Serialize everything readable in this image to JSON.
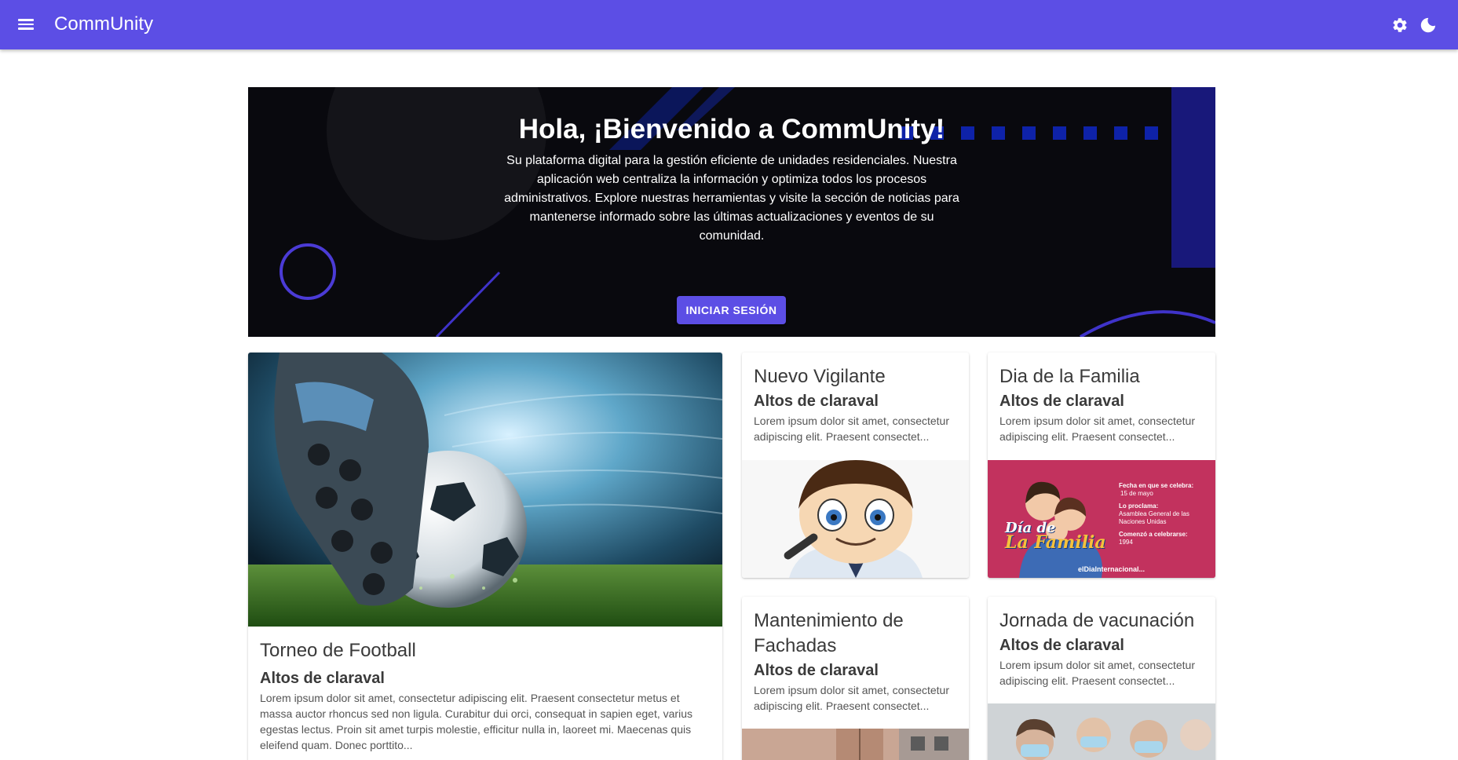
{
  "app": {
    "title": "CommUnity",
    "menu_icon": "menu-icon",
    "settings_icon": "gear-icon",
    "theme_icon": "moon-icon",
    "brand_color": "#5c4ee5"
  },
  "hero": {
    "title": "Hola, ¡Bienvenido a CommUnity!",
    "description": "Su plataforma digital para la gestión eficiente de unidades residenciales. Nuestra aplicación web centraliza la información y optimiza todos los procesos administrativos. Explore nuestras herramientas y visite la sección de noticias para mantenerse informado sobre las últimas actualizaciones y eventos de su comunidad.",
    "login_label": "INICIAR SESIÓN"
  },
  "news": [
    {
      "title": "Torneo de Football",
      "subtitle": "Altos de claraval",
      "text": "Lorem ipsum dolor sit amet, consectetur adipiscing elit. Praesent consectetur metus et massa auctor rhoncus sed non ligula. Curabitur dui orci, consequat in sapien eget, varius egestas lectus. Proin sit amet turpis molestie, efficitur nulla in, laoreet mi. Maecenas quis eleifend quam. Donec porttito..."
    },
    {
      "title": "Nuevo Vigilante",
      "subtitle": "Altos de claraval",
      "text": "Lorem ipsum dolor sit amet, consectetur adipiscing elit. Praesent consectet..."
    },
    {
      "title": "Dia de la Familia",
      "subtitle": "Altos de claraval",
      "text": "Lorem ipsum dolor sit amet, consectetur adipiscing elit. Praesent consectet...",
      "image_text": {
        "line1": "Día de",
        "line2": "La Familia",
        "fecha_label": "Fecha en que se celebra:",
        "fecha_value": "15 de mayo",
        "proclama_label": "Lo proclama:",
        "proclama_value": "Asamblea General de las Naciones Unidas",
        "comenzo_label": "Comenzó a celebrarse:",
        "comenzo_value": "1994",
        "source": "elDiaInternacional..."
      }
    },
    {
      "title": "Mantenimiento de Fachadas",
      "subtitle": "Altos de claraval",
      "text": "Lorem ipsum dolor sit amet, consectetur adipiscing elit. Praesent consectet..."
    },
    {
      "title": "Jornada de vacunación",
      "subtitle": "Altos de claraval",
      "text": "Lorem ipsum dolor sit amet, consectetur adipiscing elit. Praesent consectet..."
    }
  ]
}
